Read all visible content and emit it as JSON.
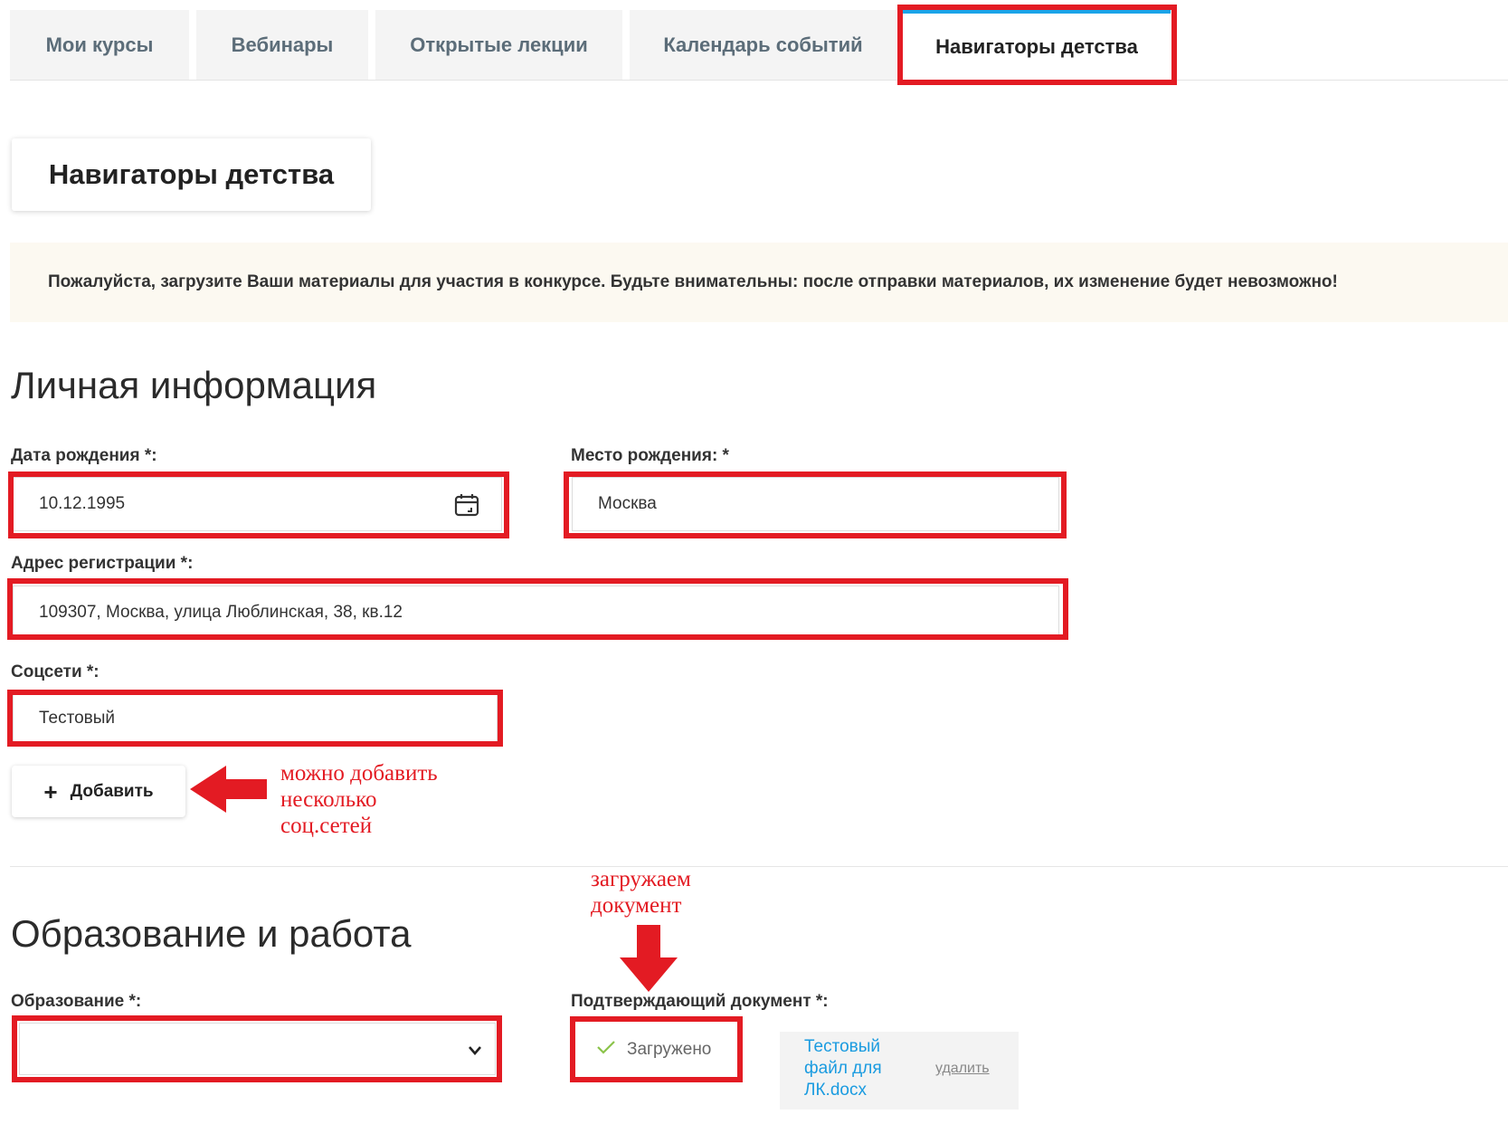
{
  "tabs": [
    {
      "label": "Мои курсы"
    },
    {
      "label": "Вебинары"
    },
    {
      "label": "Открытые лекции"
    },
    {
      "label": "Календарь событий"
    },
    {
      "label": "Навигаторы детства",
      "active": true
    }
  ],
  "page": {
    "title": "Навигаторы детства",
    "notice": "Пожалуйста, загрузите Ваши материалы для участия в конкурсе. Будьте внимательны: после отправки материалов, их изменение будет невозможно!"
  },
  "personal": {
    "heading": "Личная информация",
    "birth_date": {
      "label": "Дата рождения *:",
      "value": "10.12.1995"
    },
    "birth_place": {
      "label": "Место рождения: *",
      "value": "Москва"
    },
    "address": {
      "label": "Адрес регистрации *:",
      "value": "109307, Москва, улица Люблинская, 38, кв.12"
    },
    "social": {
      "label": "Соцсети *:",
      "value": "Тестовый"
    },
    "add_button": {
      "icon": "plus-icon",
      "label": "Добавить"
    }
  },
  "education": {
    "heading": "Образование и работа",
    "education_field": {
      "label": "Образование *:",
      "value": ""
    },
    "document": {
      "label": "Подтверждающий документ *:",
      "status": "Загружено"
    },
    "file": {
      "name_line1": "Тестовый",
      "name_line2": "файл для",
      "name_line3": "ЛК.docx",
      "delete": "удалить"
    }
  },
  "annotations": {
    "add_note_line1": "можно добавить",
    "add_note_line2": "несколько",
    "add_note_line3": "соц.сетей",
    "upload_note_line1": "загружаем",
    "upload_note_line2": "документ"
  },
  "colors": {
    "highlight": "#e31b23",
    "tab_accent": "#1aa3e8",
    "link": "#1a9be0",
    "notice_bg": "#fcf9f1"
  }
}
